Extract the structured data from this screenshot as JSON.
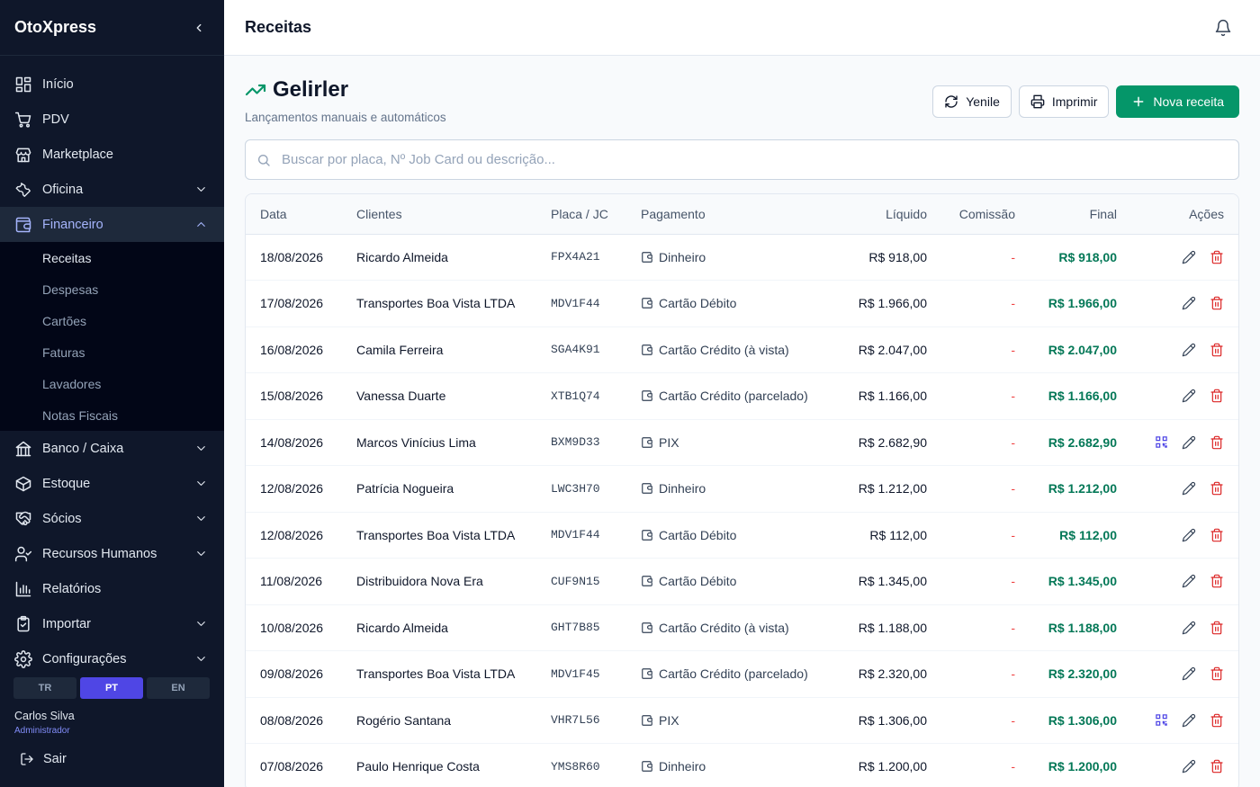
{
  "app": {
    "name": "OtoXpress"
  },
  "sidebar": {
    "items": [
      {
        "label": "Início",
        "icon": "dashboard-icon"
      },
      {
        "label": "PDV",
        "icon": "cart-icon"
      },
      {
        "label": "Marketplace",
        "icon": "store-icon"
      },
      {
        "label": "Oficina",
        "icon": "wrench-icon",
        "expandable": true
      },
      {
        "label": "Financeiro",
        "icon": "wallet-icon",
        "expandable": true,
        "expanded": true
      },
      {
        "label": "Banco / Caixa",
        "icon": "bank-icon",
        "expandable": true
      },
      {
        "label": "Estoque",
        "icon": "box-icon",
        "expandable": true
      },
      {
        "label": "Sócios",
        "icon": "handshake-icon",
        "expandable": true
      },
      {
        "label": "Recursos Humanos",
        "icon": "user-check-icon",
        "expandable": true
      },
      {
        "label": "Relatórios",
        "icon": "bar-chart-icon"
      },
      {
        "label": "Importar",
        "icon": "clipboard-icon",
        "expandable": true
      },
      {
        "label": "Configurações",
        "icon": "gear-icon",
        "expandable": true
      }
    ],
    "financeiro_sub": [
      "Receitas",
      "Despesas",
      "Cartões",
      "Faturas",
      "Lavadores",
      "Notas Fiscais"
    ],
    "languages": [
      "TR",
      "PT",
      "EN"
    ],
    "active_language": "PT",
    "user": {
      "name": "Carlos Silva",
      "role": "Administrador"
    },
    "logout": "Sair"
  },
  "topbar": {
    "title": "Receitas"
  },
  "page": {
    "title": "Gelirler",
    "subtitle": "Lançamentos manuais e automáticos",
    "buttons": {
      "refresh": "Yenile",
      "print": "Imprimir",
      "new": "Nova receita"
    },
    "search_placeholder": "Buscar por placa, Nº Job Card ou descrição..."
  },
  "table": {
    "headers": [
      "Data",
      "Clientes",
      "Placa / JC",
      "Pagamento",
      "Líquido",
      "Comissão",
      "Final",
      "Ações"
    ],
    "rows": [
      {
        "date": "18/08/2026",
        "client": "Ricardo Almeida",
        "plate": "FPX4A21",
        "payment": "Dinheiro",
        "net": "R$ 918,00",
        "commission": "-",
        "final": "R$ 918,00",
        "qr": false
      },
      {
        "date": "17/08/2026",
        "client": "Transportes Boa Vista LTDA",
        "plate": "MDV1F44",
        "payment": "Cartão Débito",
        "net": "R$ 1.966,00",
        "commission": "-",
        "final": "R$ 1.966,00",
        "qr": false
      },
      {
        "date": "16/08/2026",
        "client": "Camila Ferreira",
        "plate": "SGA4K91",
        "payment": "Cartão Crédito (à vista)",
        "net": "R$ 2.047,00",
        "commission": "-",
        "final": "R$ 2.047,00",
        "qr": false
      },
      {
        "date": "15/08/2026",
        "client": "Vanessa Duarte",
        "plate": "XTB1Q74",
        "payment": "Cartão Crédito (parcelado)",
        "net": "R$ 1.166,00",
        "commission": "-",
        "final": "R$ 1.166,00",
        "qr": false
      },
      {
        "date": "14/08/2026",
        "client": "Marcos Vinícius Lima",
        "plate": "BXM9D33",
        "payment": "PIX",
        "net": "R$ 2.682,90",
        "commission": "-",
        "final": "R$ 2.682,90",
        "qr": true
      },
      {
        "date": "12/08/2026",
        "client": "Patrícia Nogueira",
        "plate": "LWC3H70",
        "payment": "Dinheiro",
        "net": "R$ 1.212,00",
        "commission": "-",
        "final": "R$ 1.212,00",
        "qr": false
      },
      {
        "date": "12/08/2026",
        "client": "Transportes Boa Vista LTDA",
        "plate": "MDV1F44",
        "payment": "Cartão Débito",
        "net": "R$ 112,00",
        "commission": "-",
        "final": "R$ 112,00",
        "qr": false
      },
      {
        "date": "11/08/2026",
        "client": "Distribuidora Nova Era",
        "plate": "CUF9N15",
        "payment": "Cartão Débito",
        "net": "R$ 1.345,00",
        "commission": "-",
        "final": "R$ 1.345,00",
        "qr": false
      },
      {
        "date": "10/08/2026",
        "client": "Ricardo Almeida",
        "plate": "GHT7B85",
        "payment": "Cartão Crédito (à vista)",
        "net": "R$ 1.188,00",
        "commission": "-",
        "final": "R$ 1.188,00",
        "qr": false
      },
      {
        "date": "09/08/2026",
        "client": "Transportes Boa Vista LTDA",
        "plate": "MDV1F45",
        "payment": "Cartão Crédito (parcelado)",
        "net": "R$ 2.320,00",
        "commission": "-",
        "final": "R$ 2.320,00",
        "qr": false
      },
      {
        "date": "08/08/2026",
        "client": "Rogério Santana",
        "plate": "VHR7L56",
        "payment": "PIX",
        "net": "R$ 1.306,00",
        "commission": "-",
        "final": "R$ 1.306,00",
        "qr": true
      },
      {
        "date": "07/08/2026",
        "client": "Paulo Henrique Costa",
        "plate": "YMS8R60",
        "payment": "Dinheiro",
        "net": "R$ 1.200,00",
        "commission": "-",
        "final": "R$ 1.200,00",
        "qr": false
      }
    ]
  },
  "colors": {
    "sidebar": "#0f172a",
    "accent": "#4f46e5",
    "success": "#059669",
    "final": "#047857",
    "danger": "#dc2626"
  }
}
